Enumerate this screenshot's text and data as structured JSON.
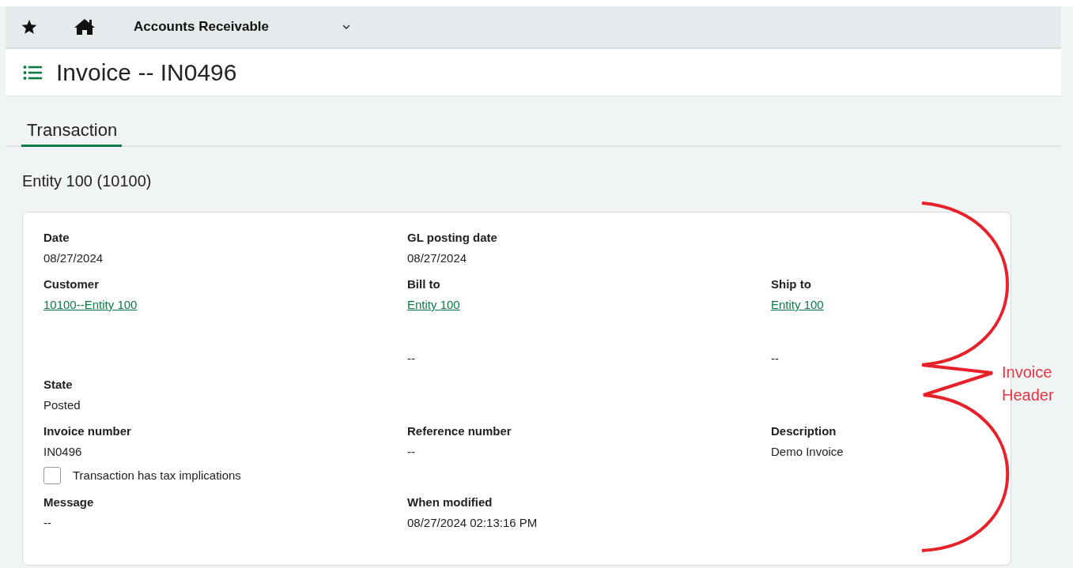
{
  "nav": {
    "module": "Accounts Receivable"
  },
  "page": {
    "title": "Invoice -- IN0496"
  },
  "tabs": [
    {
      "label": "Transaction",
      "selected": true
    }
  ],
  "entity": "Entity 100 (10100)",
  "rows": [
    {
      "kind": "fields",
      "fields": [
        {
          "label": "Date",
          "value": "08/27/2024",
          "kind": "text"
        },
        {
          "label": "GL posting date",
          "value": "08/27/2024",
          "kind": "text"
        }
      ]
    },
    {
      "kind": "fields",
      "fields": [
        {
          "label": "Customer",
          "value": "10100--Entity 100",
          "kind": "link"
        },
        {
          "label": "Bill to",
          "value": "Entity 100",
          "kind": "link",
          "note": "--"
        },
        {
          "label": "Ship to",
          "value": "Entity 100",
          "kind": "link",
          "note": "--"
        }
      ]
    },
    {
      "kind": "fields",
      "fields": [
        {
          "label": "State",
          "value": "Posted",
          "kind": "text"
        }
      ]
    },
    {
      "kind": "fields",
      "fields": [
        {
          "label": "Invoice number",
          "value": "IN0496",
          "kind": "text"
        },
        {
          "label": "Reference number",
          "value": "--",
          "kind": "text"
        },
        {
          "label": "Description",
          "value": "Demo Invoice",
          "kind": "text"
        }
      ]
    },
    {
      "kind": "checkbox",
      "label": "Transaction has tax implications",
      "checked": false
    },
    {
      "kind": "fields",
      "fields": [
        {
          "label": "Message",
          "value": "--",
          "kind": "text"
        },
        {
          "label": "When modified",
          "value": "08/27/2024 02:13:16 PM",
          "kind": "text"
        }
      ]
    }
  ],
  "annotation": {
    "text": "Invoice Header"
  }
}
